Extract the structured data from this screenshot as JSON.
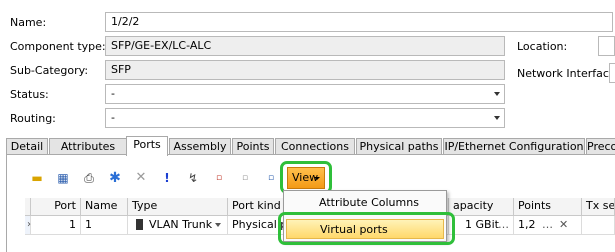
{
  "form": {
    "name_label": "Name:",
    "name_value": "1/2/2",
    "component_type_label": "Component type:",
    "component_type_value": "SFP/GE-EX/LC-ALC",
    "sub_category_label": "Sub-Category:",
    "sub_category_value": "SFP",
    "status_label": "Status:",
    "status_value": "-",
    "routing_label": "Routing:",
    "routing_value": "-",
    "location_label": "Location:",
    "network_interface_label": "Network Interface:"
  },
  "tabs": [
    {
      "label": "Detail"
    },
    {
      "label": "Attributes"
    },
    {
      "label": "Ports",
      "active": true
    },
    {
      "label": "Assembly"
    },
    {
      "label": "Points"
    },
    {
      "label": "Connections"
    },
    {
      "label": "Physical paths"
    },
    {
      "label": "IP/Ethernet Configuration"
    },
    {
      "label": "Preco"
    }
  ],
  "toolbar": {
    "view_label": "View",
    "icons": [
      "filter-icon",
      "columns-icon",
      "print-icon",
      "asterisk-icon",
      "delete-icon",
      "exclamation-icon",
      "wrench-icon",
      "copy-port-icon",
      "paste-port-icon"
    ]
  },
  "grid": {
    "columns": [
      "Port",
      "Name",
      "Type",
      "Port kind",
      "apacity",
      "Points",
      "Tx se"
    ],
    "row": {
      "port": "1",
      "name": "1",
      "type": "VLAN Trunk",
      "port_kind": "Physical po",
      "capacity": "1 GBit",
      "points": "1,2"
    }
  },
  "view_menu": {
    "items": [
      {
        "label": "Attribute Columns"
      },
      {
        "label": "Virtual ports",
        "highlighted": true
      }
    ]
  },
  "colors": {
    "highlight_green": "#2fbf3a",
    "view_button": "#f39a16",
    "menu_highlight": "#ffd86b"
  }
}
